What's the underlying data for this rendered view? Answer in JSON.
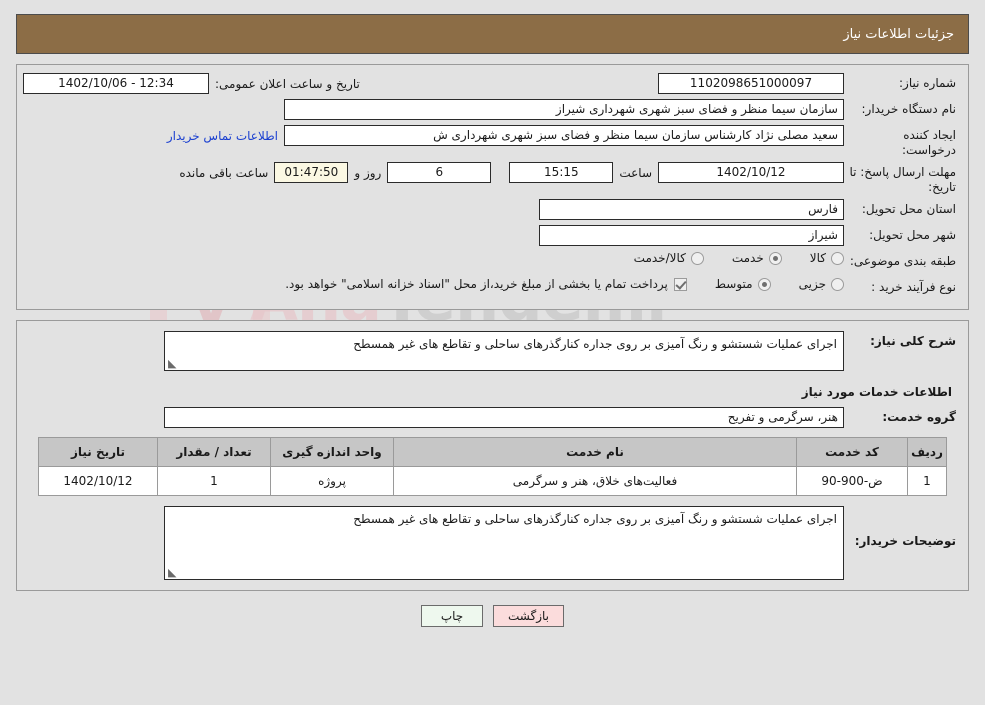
{
  "header": {
    "title": "جزئیات اطلاعات نیاز"
  },
  "form": {
    "need_no_label": "شماره نیاز:",
    "need_no_value": "1102098651000097",
    "announce_label": "تاریخ و ساعت اعلان عمومی:",
    "announce_value": "12:34 - 1402/10/06",
    "buyer_label": "نام دستگاه خریدار:",
    "buyer_value": "سازمان سیما منظر و فضای سبز شهری شهرداری شیراز",
    "requester_label": "ایجاد کننده درخواست:",
    "requester_value": "سعید مصلی نژاد کارشناس سازمان سیما منظر و فضای سبز شهری شهرداری ش",
    "contact_link": "اطلاعات تماس خریدار",
    "deadline_label": "مهلت ارسال پاسخ: تا تاریخ:",
    "deadline_date": "1402/10/12",
    "deadline_hour_label": "ساعت",
    "deadline_hour": "15:15",
    "days_left": "6",
    "days_label": "روز و",
    "countdown": "01:47:50",
    "countdown_label": "ساعت باقی مانده",
    "province_label": "استان محل تحویل:",
    "province_value": "فارس",
    "city_label": "شهر محل تحویل:",
    "city_value": "شیراز",
    "category_label": "طبقه بندی موضوعی:",
    "category_options": [
      {
        "label": "کالا",
        "selected": false
      },
      {
        "label": "خدمت",
        "selected": true
      },
      {
        "label": "کالا/خدمت",
        "selected": false
      }
    ],
    "process_label": "نوع فرآیند خرید :",
    "process_options": [
      {
        "label": "جزیی",
        "selected": false
      },
      {
        "label": "متوسط",
        "selected": true
      }
    ],
    "treasury_checked": true,
    "treasury_note": "پرداخت تمام یا بخشی از مبلغ خرید،از محل \"اسناد خزانه اسلامی\" خواهد بود."
  },
  "summary": {
    "label": "شرح کلی نیاز:",
    "value": "اجرای عملیات شستشو و رنگ آمیزی بر روی جداره کنارگذرهای ساحلی و تقاطع های غیر همسطح"
  },
  "services": {
    "section_title": "اطلاعات خدمات مورد نیاز",
    "group_label": "گروه خدمت:",
    "group_value": "هنر، سرگرمی و تفریح",
    "table": {
      "headers": [
        "ردیف",
        "کد خدمت",
        "نام خدمت",
        "واحد اندازه گیری",
        "تعداد / مقدار",
        "تاریخ نیاز"
      ],
      "rows": [
        {
          "row": "1",
          "code": "ض-900-90",
          "name": "فعالیت‌های خلاق، هنر و سرگرمی",
          "unit": "پروژه",
          "qty": "1",
          "date": "1402/10/12"
        }
      ]
    }
  },
  "buyer_notes": {
    "label": "توضیحات خریدار:",
    "value": "اجرای عملیات شستشو و رنگ آمیزی بر روی جداره کنارگذرهای ساحلی و تقاطع های غیر همسطح"
  },
  "footer": {
    "print_label": "چاپ",
    "back_label": "بازگشت"
  },
  "watermark": {
    "text_left": "Ana",
    "text_right": "Tender.ir"
  },
  "colors": {
    "header_bg": "#8c6d46",
    "page_bg": "#e2e2e2",
    "link": "#1a3fd0",
    "print_btn": "#eef8ee",
    "back_btn": "#fbdcdc",
    "table_header": "#c6c6c6"
  }
}
